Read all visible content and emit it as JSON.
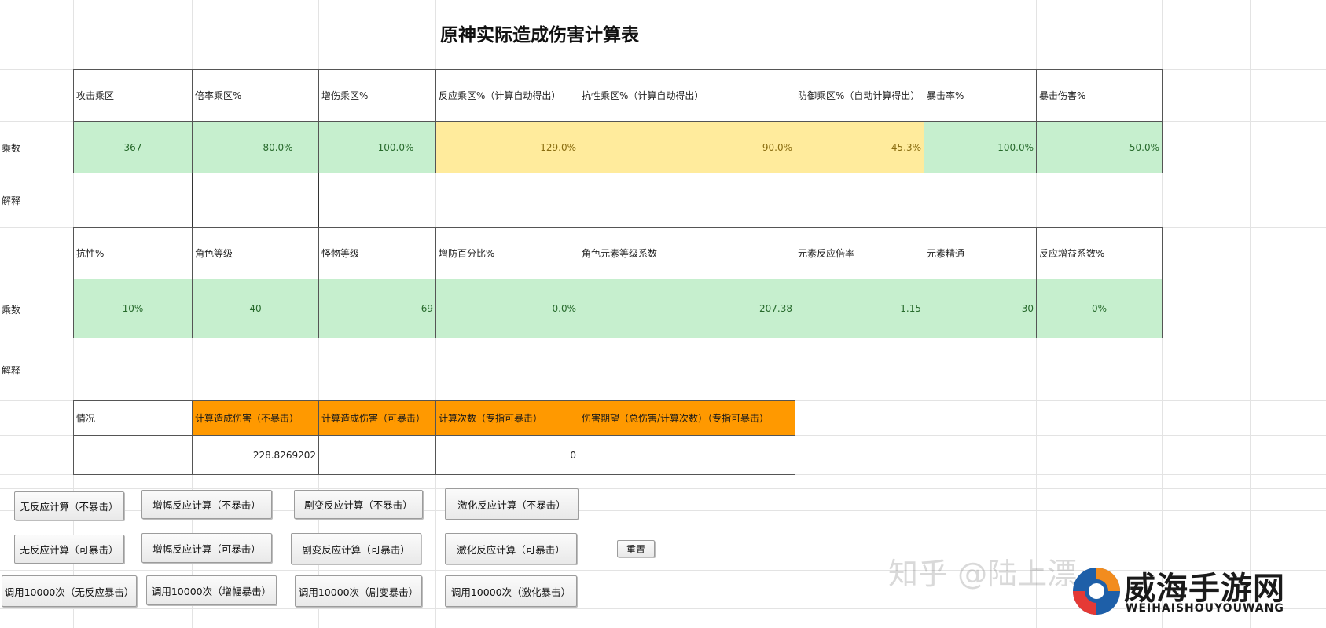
{
  "title": "原神实际造成伤害计算表",
  "table1": {
    "headers": [
      "攻击乘区",
      "倍率乘区%",
      "增伤乘区%",
      "反应乘区%（计算自动得出）",
      "抗性乘区%（计算自动得出）",
      "防御乘区%（自动计算得出）",
      "暴击率%",
      "暴击伤害%"
    ],
    "values": [
      "367",
      "80.0%",
      "100.0%",
      "129.0%",
      "90.0%",
      "45.3%",
      "100.0%",
      "50.0%"
    ]
  },
  "table2": {
    "headers": [
      "抗性%",
      "角色等级",
      "怪物等级",
      "增防百分比%",
      "角色元素等级系数",
      "元素反应倍率",
      "元素精通",
      "反应增益系数%"
    ],
    "values": [
      "10%",
      "40",
      "69",
      "0.0%",
      "207.38",
      "1.15",
      "30",
      "0%"
    ]
  },
  "row_labels": {
    "coef": "乘数",
    "explain": "解释"
  },
  "table3": {
    "headers": [
      "情况",
      "计算造成伤害（不暴击）",
      "计算造成伤害（可暴击）",
      "计算次数（专指可暴击）",
      "伤害期望（总伤害/计算次数）（专指可暴击）"
    ],
    "values": [
      "",
      "228.8269202",
      "",
      "0",
      ""
    ]
  },
  "buttons": {
    "row1": [
      "无反应计算（不暴击）",
      "增幅反应计算（不暴击）",
      "剧变反应计算（不暴击）",
      "激化反应计算（不暴击）"
    ],
    "row2": [
      "无反应计算（可暴击）",
      "增幅反应计算（可暴击）",
      "剧变反应计算（可暴击）",
      "激化反应计算（可暴击）"
    ],
    "reset": "重置",
    "row3": [
      "调用10000次（无反应暴击）",
      "调用10000次（增幅暴击）",
      "调用10000次（剧变暴击）",
      "调用10000次（激化暴击）"
    ]
  },
  "watermark": {
    "text": "知乎 @陆上漂",
    "brand_cn": "威海手游网",
    "brand_en": "WEIHAISHOUYOUWANG"
  },
  "colors": {
    "green": "#c6efce",
    "yellow": "#ffeb9c",
    "orange": "#ff9900"
  }
}
